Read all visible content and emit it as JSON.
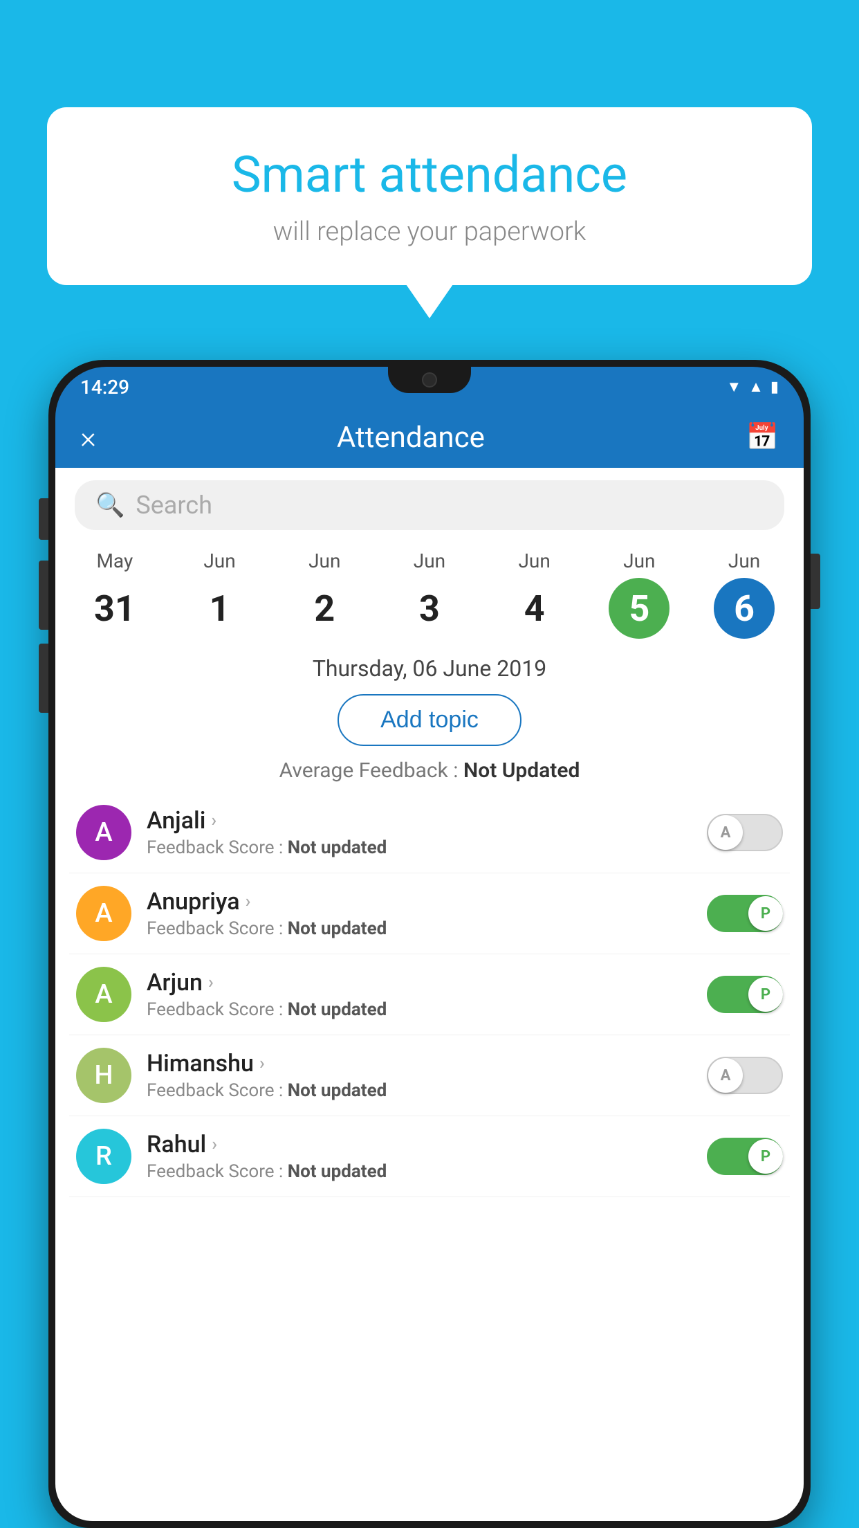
{
  "background_color": "#1ab8e8",
  "speech_bubble": {
    "title": "Smart attendance",
    "subtitle": "will replace your paperwork"
  },
  "status_bar": {
    "time": "14:29",
    "icons": [
      "wifi",
      "signal",
      "battery"
    ]
  },
  "app_bar": {
    "close_label": "×",
    "title": "Attendance",
    "calendar_icon": "📅"
  },
  "search": {
    "placeholder": "Search"
  },
  "calendar": {
    "days": [
      {
        "month": "May",
        "date": "31",
        "state": "normal"
      },
      {
        "month": "Jun",
        "date": "1",
        "state": "normal"
      },
      {
        "month": "Jun",
        "date": "2",
        "state": "normal"
      },
      {
        "month": "Jun",
        "date": "3",
        "state": "normal"
      },
      {
        "month": "Jun",
        "date": "4",
        "state": "normal"
      },
      {
        "month": "Jun",
        "date": "5",
        "state": "today"
      },
      {
        "month": "Jun",
        "date": "6",
        "state": "selected"
      }
    ]
  },
  "selected_date_label": "Thursday, 06 June 2019",
  "add_topic_button": "Add topic",
  "average_feedback": {
    "label": "Average Feedback : ",
    "value": "Not Updated"
  },
  "students": [
    {
      "name": "Anjali",
      "initial": "A",
      "avatar_color": "#9c27b0",
      "feedback_label": "Feedback Score : ",
      "feedback_value": "Not updated",
      "toggle_state": "off",
      "toggle_letter": "A"
    },
    {
      "name": "Anupriya",
      "initial": "A",
      "avatar_color": "#ffa726",
      "feedback_label": "Feedback Score : ",
      "feedback_value": "Not updated",
      "toggle_state": "on",
      "toggle_letter": "P"
    },
    {
      "name": "Arjun",
      "initial": "A",
      "avatar_color": "#8bc34a",
      "feedback_label": "Feedback Score : ",
      "feedback_value": "Not updated",
      "toggle_state": "on",
      "toggle_letter": "P"
    },
    {
      "name": "Himanshu",
      "initial": "H",
      "avatar_color": "#a5c46a",
      "feedback_label": "Feedback Score : ",
      "feedback_value": "Not updated",
      "toggle_state": "off",
      "toggle_letter": "A"
    },
    {
      "name": "Rahul",
      "initial": "R",
      "avatar_color": "#26c6da",
      "feedback_label": "Feedback Score : ",
      "feedback_value": "Not updated",
      "toggle_state": "on",
      "toggle_letter": "P"
    }
  ]
}
